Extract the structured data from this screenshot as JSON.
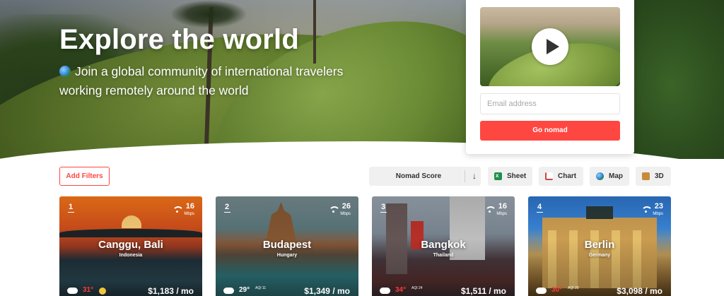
{
  "hero": {
    "title": "Explore the world",
    "subtitle": "Join a global community of international travelers working remotely around the world"
  },
  "signup": {
    "email_placeholder": "Email address",
    "button_label": "Go nomad"
  },
  "toolbar": {
    "filters_label": "Add Filters",
    "sort_label": "Nomad Score",
    "sort_arrow": "↓",
    "sheet_label": "Sheet",
    "chart_label": "Chart",
    "map_label": "Map",
    "threed_label": "3D"
  },
  "cities": [
    {
      "rank": "1",
      "name": "Canggu, Bali",
      "country": "Indonesia",
      "internet": "16",
      "internet_unit": "Mbps",
      "temp": "31°",
      "aqi": "",
      "cost": "$1,183 / mo"
    },
    {
      "rank": "2",
      "name": "Budapest",
      "country": "Hungary",
      "internet": "26",
      "internet_unit": "Mbps",
      "temp": "29°",
      "aqi": "AQI 11",
      "cost": "$1,349 / mo"
    },
    {
      "rank": "3",
      "name": "Bangkok",
      "country": "Thailand",
      "internet": "16",
      "internet_unit": "Mbps",
      "temp": "34°",
      "aqi": "AQI 24",
      "cost": "$1,511 / mo"
    },
    {
      "rank": "4",
      "name": "Berlin",
      "country": "Germany",
      "internet": "23",
      "internet_unit": "Mbps",
      "temp": "30°",
      "aqi": "AQI 20",
      "cost": "$3,098 / mo"
    }
  ],
  "colors": {
    "accent": "#ff4742",
    "toolbar_bg": "#f0f0f0"
  },
  "icons": {
    "globe": "globe-icon",
    "play": "play-icon",
    "sheet": "spreadsheet-icon",
    "chart": "chart-icon",
    "map": "map-globe-icon",
    "threed": "cube-icon",
    "wifi": "wifi-icon",
    "weather": "cloud-icon"
  }
}
